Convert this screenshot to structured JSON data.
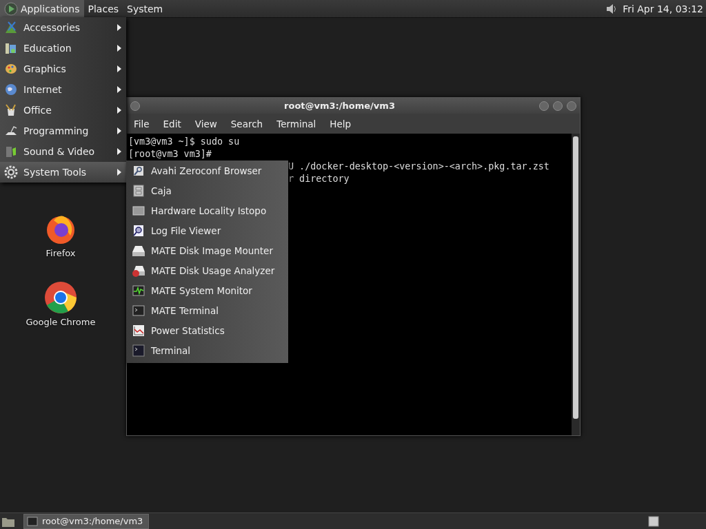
{
  "top_panel": {
    "menus": [
      {
        "label": "Applications",
        "selected": true
      },
      {
        "label": "Places",
        "selected": false
      },
      {
        "label": "System",
        "selected": false
      }
    ],
    "clock": "Fri Apr 14, 03:12"
  },
  "desktop_icons": [
    {
      "label": "Firefox",
      "kind": "firefox"
    },
    {
      "label": "Google Chrome",
      "kind": "chrome"
    }
  ],
  "terminal_window": {
    "title": "root@vm3:/home/vm3",
    "menu": [
      "File",
      "Edit",
      "View",
      "Search",
      "Terminal",
      "Help"
    ],
    "lines": [
      {
        "text": "[vm3@vm3 ~]$ sudo su",
        "kind": "full"
      },
      {
        "text": "[root@vm3 vm3]#",
        "kind": "full"
      },
      {
        "text": "U ./docker-desktop-<version>-<arch>.pkg.tar.zst",
        "kind": "partial"
      },
      {
        "text": "r directory",
        "kind": "partial"
      }
    ]
  },
  "applications_menu": {
    "items": [
      {
        "label": "Accessories",
        "kind": "accessories",
        "selected": false
      },
      {
        "label": "Education",
        "kind": "education",
        "selected": false
      },
      {
        "label": "Graphics",
        "kind": "graphics",
        "selected": false
      },
      {
        "label": "Internet",
        "kind": "internet",
        "selected": false
      },
      {
        "label": "Office",
        "kind": "office",
        "selected": false
      },
      {
        "label": "Programming",
        "kind": "programming",
        "selected": false
      },
      {
        "label": "Sound & Video",
        "kind": "sound",
        "selected": false
      },
      {
        "label": "System Tools",
        "kind": "gear",
        "selected": true
      }
    ]
  },
  "system_tools_submenu": {
    "items": [
      {
        "label": "Avahi Zeroconf Browser",
        "kind": "avahi"
      },
      {
        "label": "Caja",
        "kind": "cabinet"
      },
      {
        "label": "Hardware Locality Istopo",
        "kind": "hw"
      },
      {
        "label": "Log File Viewer",
        "kind": "magnifier"
      },
      {
        "label": "MATE Disk Image Mounter",
        "kind": "disk"
      },
      {
        "label": "MATE Disk Usage Analyzer",
        "kind": "diskpie"
      },
      {
        "label": "MATE System Monitor",
        "kind": "monitor"
      },
      {
        "label": "MATE Terminal",
        "kind": "terminal"
      },
      {
        "label": "Power Statistics",
        "kind": "chart"
      },
      {
        "label": "Terminal",
        "kind": "terminal2"
      }
    ]
  },
  "bottom_panel": {
    "tasks": [
      {
        "label": "root@vm3:/home/vm3",
        "selected": true
      }
    ]
  }
}
